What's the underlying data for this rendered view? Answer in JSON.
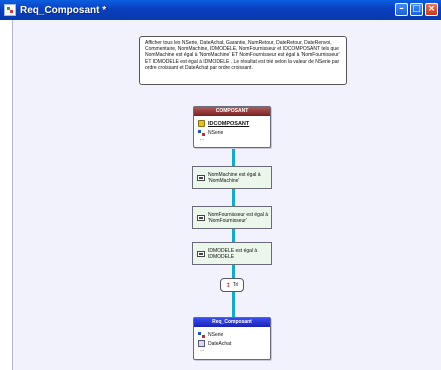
{
  "window": {
    "title": "Req_Composant *"
  },
  "comment": {
    "text": "Afficher tous les NSerie, DateAchat, Garantie, NumRetour, DateRetour, DateRenvoi, Commentaire, NomMachine, IDMODELE, NomFournisseur et IDCOMPOSANT  tels que NomMachine est égal à 'NomMachine' ET NomFournisseur est égal à 'NomFournisseur' ET IDMODELE est égal à IDMODELE . Le résultat est trié selon la valeur de NSerie par ordre croissant et DateAchat par ordre croissant."
  },
  "source_table": {
    "name": "COMPOSANT",
    "key_field": "IDCOMPOSANT",
    "field": "NSerie",
    "more": "..."
  },
  "conditions": [
    {
      "line1": "NomMachine est égal à",
      "line2": "'NomMachine'"
    },
    {
      "line1": "NomFournisseur est égal à",
      "line2": "'NomFournisseur'"
    },
    {
      "line1": "IDMODELE est égal à",
      "line2": "IDMODELE"
    }
  ],
  "sort": {
    "label": "Tri"
  },
  "result_table": {
    "name": "Req_Composant",
    "field1": "NSerie",
    "field2": "DateAchat",
    "more": "..."
  },
  "colors": {
    "titlebar": "#0a3fbf",
    "link": "#1aa7c4",
    "condition_bg": "#eaf7ea",
    "source_header": "#7a1f1f",
    "result_header": "#1a23b5"
  }
}
